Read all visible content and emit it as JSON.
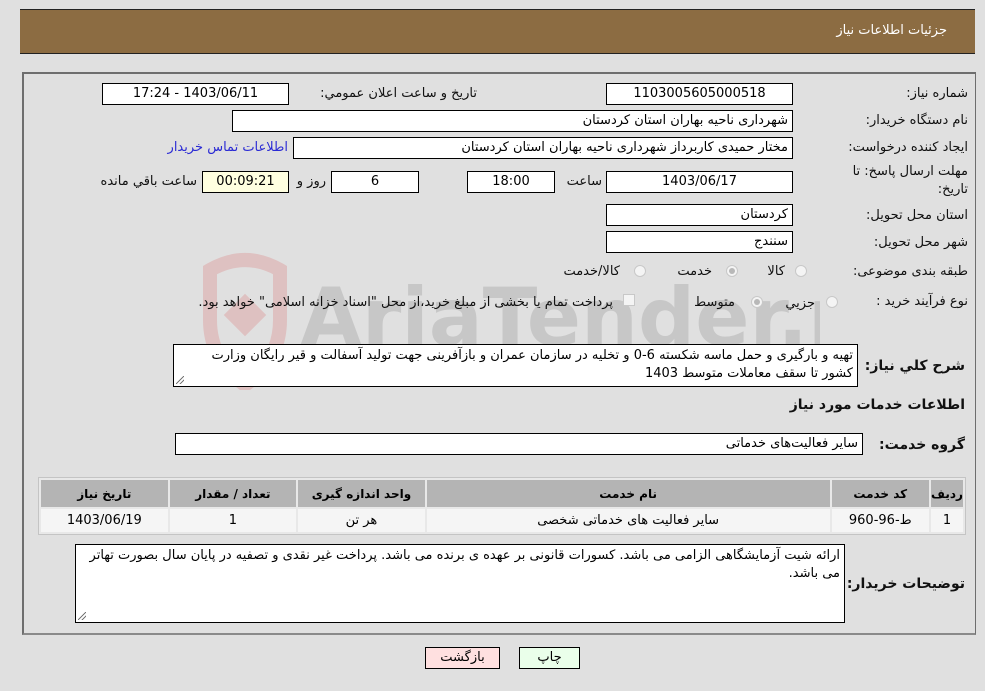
{
  "header": {
    "title": "جزئیات اطلاعات نیاز"
  },
  "form": {
    "need_number": {
      "label": "شماره نیاز:",
      "value": "1103005605000518"
    },
    "announce_datetime": {
      "label": "تاریخ و ساعت اعلان عمومي:",
      "value": "1403/06/11 - 17:24"
    },
    "buyer_org": {
      "label": "نام دستگاه خريدار:",
      "value": "شهرداری ناحیه بهاران استان کردستان"
    },
    "creator": {
      "label": "ايجاد کننده درخواست:",
      "value": "مختار حمیدی کاربرداز شهرداری ناحیه بهاران استان کردستان",
      "contact_link": "اطلاعات تماس خريدار"
    },
    "deadline": {
      "label_line1": "مهلت ارسال پاسخ: تا",
      "label_line2": "تاريخ:",
      "date": "1403/06/17",
      "time_label": "ساعت",
      "time": "18:00",
      "days": "6",
      "days_label": "روز و",
      "remaining": "00:09:21",
      "remaining_label": "ساعت باقي مانده"
    },
    "province": {
      "label": "استان محل تحويل:",
      "value": "کردستان"
    },
    "city": {
      "label": "شهر محل تحويل:",
      "value": "سنندج"
    },
    "category": {
      "label": "طبقه بندی موضوعی:",
      "options": [
        {
          "label": "کالا",
          "checked": false
        },
        {
          "label": "خدمت",
          "checked": true
        },
        {
          "label": "کالا/خدمت",
          "checked": false
        }
      ]
    },
    "purchase_type": {
      "label": "نوع فرآيند خريد :",
      "options": [
        {
          "label": "جزيي",
          "checked": false
        },
        {
          "label": "متوسط",
          "checked": true
        }
      ],
      "treasury_note": "پرداخت تمام يا بخشی از مبلغ خريد،از محل \"اسناد خزانه اسلامی\" خواهد بود."
    },
    "description": {
      "label": "شرح کلي نياز:",
      "value": "تهیه و بارگیری و حمل ماسه شکسته 6-0 و تخلیه در  سازمان عمران و بازآفرینی جهت تولید آسفالت و قیر رایگان وزارت کشور تا سقف معاملات متوسط 1403"
    }
  },
  "services": {
    "section_title": "اطلاعات خدمات مورد نياز",
    "group_label": "گروه خدمت:",
    "group_value": "سایر فعالیت‌های خدماتی",
    "table": {
      "headers": [
        "رديف",
        "کد خدمت",
        "نام خدمت",
        "واحد اندازه گیری",
        "تعداد / مقدار",
        "تاريخ نياز"
      ],
      "rows": [
        [
          "1",
          "ط-96-960",
          "سایر فعالیت های خدماتی شخصی",
          "هر تن",
          "1",
          "1403/06/19"
        ]
      ]
    }
  },
  "buyer_notes": {
    "label": "توضيحات خريدار:",
    "value": "ارائه شیت آزمایشگاهی الزامی می باشد. کسورات قانونی بر عهده ی برنده می باشد. پرداخت غیر نقدی و تصفیه در پایان سال بصورت تهاتر می باشد."
  },
  "buttons": {
    "print": "چاپ",
    "back": "بازگشت"
  },
  "watermark": {
    "text": "AriaTender.neT"
  },
  "colors": {
    "header_bg": "#8c6c42",
    "print_bg": "#eaffea",
    "back_bg": "#ffe0e0",
    "remaining_bg": "#ffffe0",
    "link": "#2b2bd4"
  }
}
